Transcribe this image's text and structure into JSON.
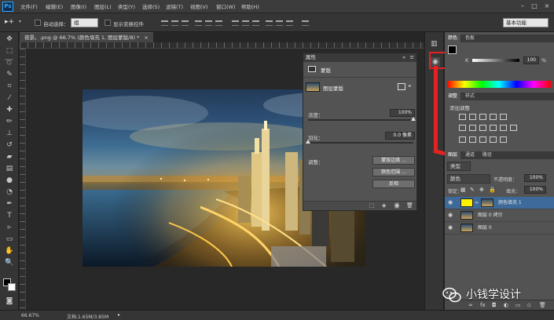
{
  "app": {
    "logo": "Ps"
  },
  "menu": [
    "文件(F)",
    "编辑(E)",
    "图像(I)",
    "图层(L)",
    "类型(Y)",
    "选择(S)",
    "滤镜(T)",
    "视图(V)",
    "窗口(W)",
    "帮助(H)"
  ],
  "options": {
    "auto_select_label": "自动选择：",
    "auto_select_value": "组",
    "transform_label": "显示变换控件",
    "workspace": "基本功能"
  },
  "document": {
    "tab_title": "夜景。.png @ 66.7% (颜色填充 1, 图层蒙版/8) *",
    "zoom": "66.67%",
    "doc_size": "文档:1.65M/3.85M"
  },
  "properties": {
    "title": "属性",
    "subtitle": "蒙版",
    "mask_label": "图层蒙版",
    "density_label": "浓度：",
    "density_value": "100%",
    "feather_label": "羽化：",
    "feather_value": "0.0 像素",
    "adjust_label": "调整：",
    "btn_mask_edge": "蒙版边缘 ...",
    "btn_color_range": "颜色范围 ...",
    "btn_invert": "反相",
    "density_fraction": 1.0,
    "feather_fraction": 0.0
  },
  "panels": {
    "color_tabs": [
      "颜色",
      "色板"
    ],
    "k_label": "K",
    "k_value": "100",
    "k_unit": "%",
    "adjust_tabs": [
      "调整",
      "样式"
    ],
    "adjust_title": "添加调整",
    "layer_tabs": [
      "图层",
      "通道",
      "路径"
    ],
    "kind_select": "类型",
    "blend_mode": "颜色",
    "opacity_label": "不透明度：",
    "opacity_value": "100%",
    "lock_label": "锁定：",
    "fill_label": "填充：",
    "fill_value": "100%",
    "layers": [
      {
        "name": "颜色填充 1",
        "selected": true,
        "fill_color": "#fff200"
      },
      {
        "name": "图层 0 拷贝",
        "selected": false
      },
      {
        "name": "图层 0",
        "selected": false
      }
    ]
  },
  "watermark": {
    "text": "小钱学设计"
  },
  "colors": {
    "accent_red": "#e52222",
    "highlight_blue": "#3d6a99"
  }
}
